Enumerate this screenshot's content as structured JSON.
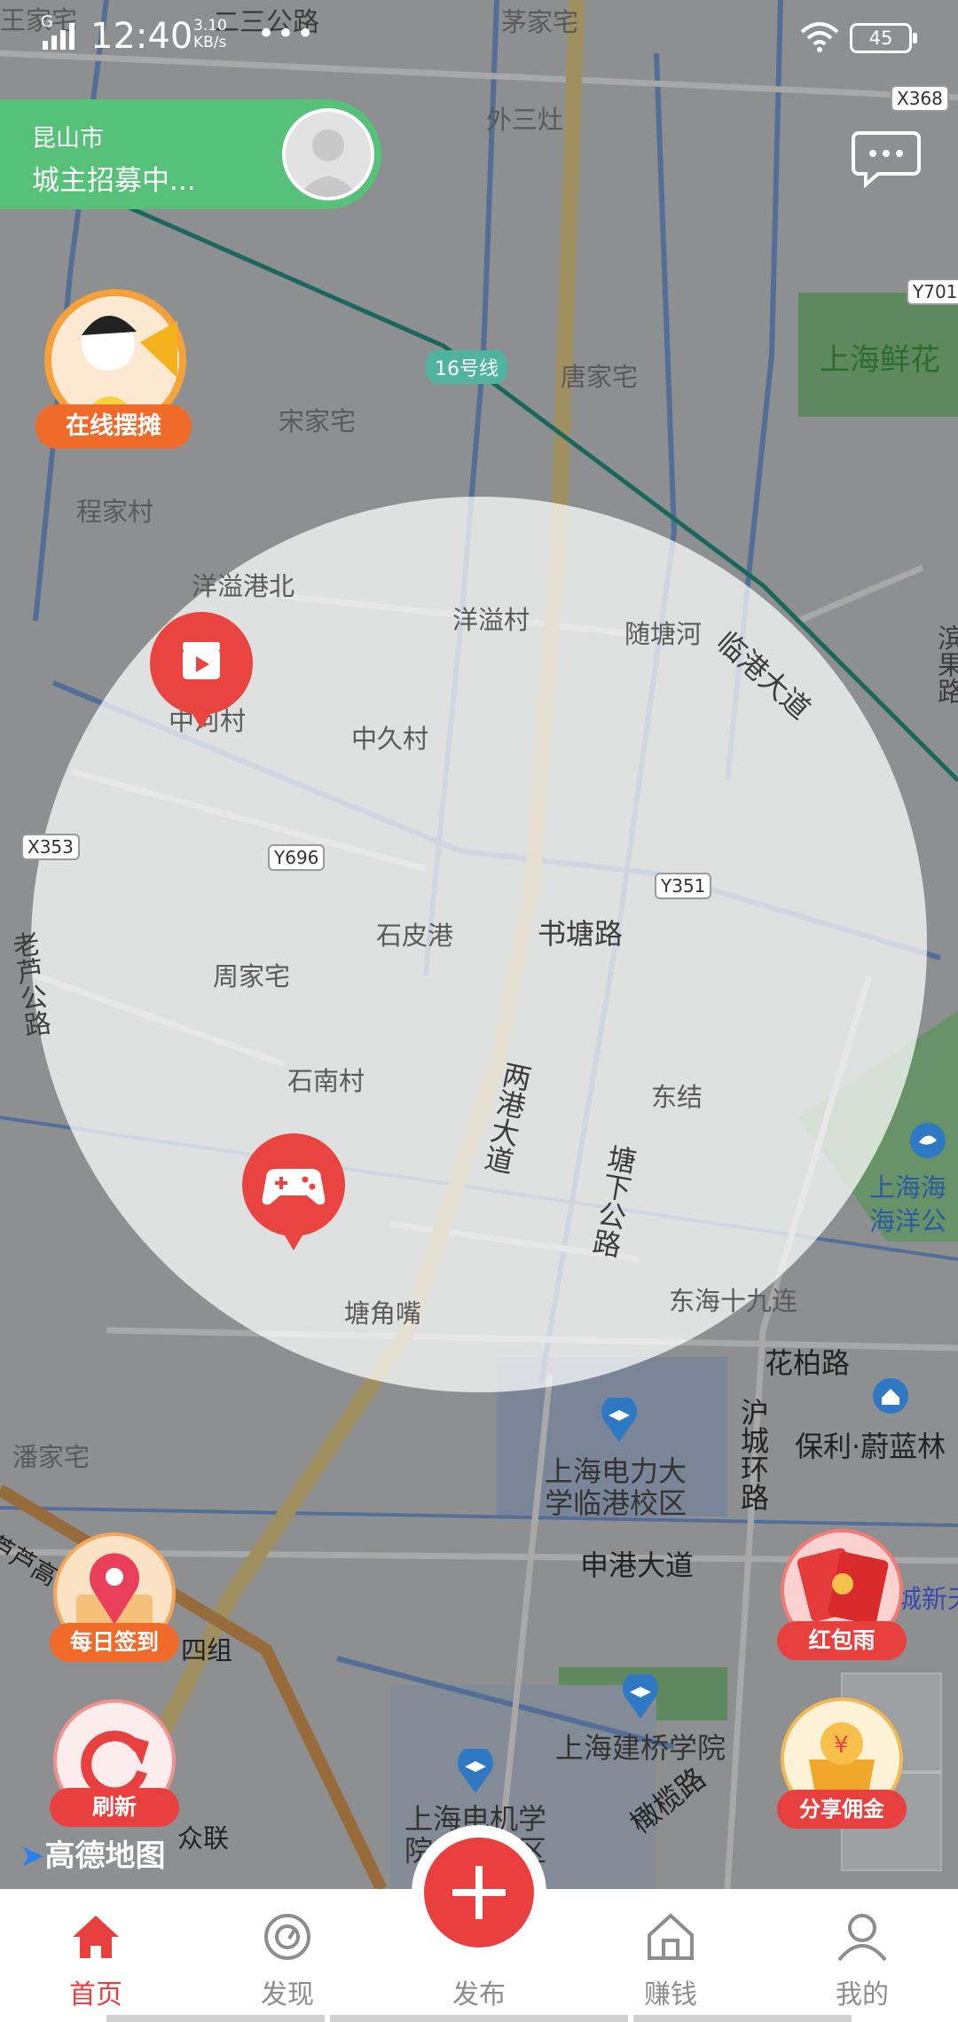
{
  "status_bar": {
    "network": "G",
    "time": "12:40",
    "speed_value": "3.10",
    "speed_unit": "KB/s",
    "more": "•••",
    "battery": "45"
  },
  "recruit": {
    "city": "昆山市",
    "subtitle": "城主招募中..."
  },
  "map": {
    "labels": {
      "maojiazhai": "茅家宅",
      "waisanzao": "外三灶",
      "tangjiazhai": "唐家宅",
      "songjiazhai": "宋家宅",
      "chengjiacun": "程家村",
      "shanghaixianhua": "上海鲜花",
      "yangyigangbei": "洋溢港北",
      "yangyicun": "洋溢村",
      "suitanghe": "随塘河",
      "zhongjiucun": "中久村",
      "zhongcun": "中河村",
      "shipigang": "石皮港",
      "shutanglu": "书塘路",
      "zhoujiazhai": "周家宅",
      "shinancun": "石南村",
      "dongjie": "东结",
      "tangjiaozui": "塘角嘴",
      "donghai19": "东海十九连",
      "huabailu": "花柏路",
      "baoli": "保利·蔚蓝林",
      "dianlidaxue1": "上海电力大",
      "dianlidaxue2": "学临港校区",
      "panjiazhai": "潘家宅",
      "shengangdadao": "申港大道",
      "jianqiao": "上海建桥学院",
      "dianji1": "上海电机学",
      "dianji2": "院临港校区",
      "sizu": "四组",
      "zhonglian": "众联",
      "haiyang1": "上海海",
      "haiyang2": "海洋公",
      "chengxin": "城新天",
      "top_road": "二三公路",
      "top_left": "王家宅"
    },
    "roads": {
      "lingangdadao": "临港大道",
      "lianggangdadao": "两港大道",
      "tangxiagonglu": "塘下公路",
      "laolugonglu": "老芦公路",
      "huchenghuanlu": "沪城环路",
      "ganlanlu": "橄榄路",
      "binguolu": "滨果路",
      "luchaogang": "芦芦高"
    },
    "codes": {
      "x368": "X368",
      "y701": "Y701",
      "x353": "X353",
      "y696": "Y696",
      "y351": "Y351"
    },
    "line_badge": "16号线",
    "attribution": "高德地图"
  },
  "buttons": {
    "stall": "在线摆摊",
    "checkin": "每日签到",
    "refresh": "刷新",
    "red_envelope": "红包雨",
    "commission": "分享佣金"
  },
  "nav": {
    "home": "首页",
    "discover": "发现",
    "publish": "发布",
    "earn": "赚钱",
    "mine": "我的"
  },
  "colors": {
    "accent_red": "#e8403f",
    "recruit_green": "#56c178",
    "orange": "#f06a2a"
  }
}
